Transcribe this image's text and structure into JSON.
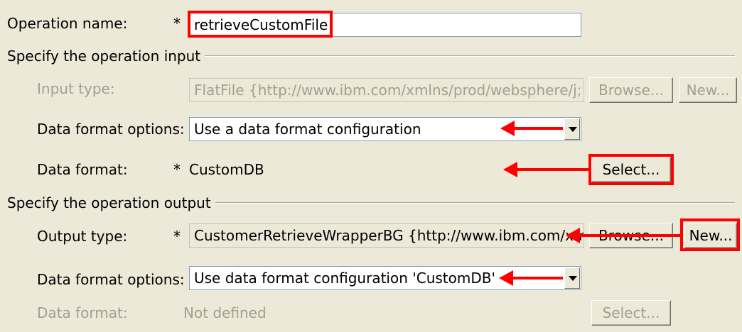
{
  "operation_name": {
    "label": "Operation name:",
    "asterisk": "*",
    "value": "retrieveCustomFile"
  },
  "input_group": {
    "title": "Specify the operation input",
    "input_type": {
      "label": "Input type:",
      "value": "FlatFile  {http://www.ibm.com/xmlns/prod/websphere/j;",
      "browse_label": "Browse...",
      "new_label": "New..."
    },
    "data_format_options": {
      "label": "Data format options:",
      "selected": "Use a data format configuration"
    },
    "data_format": {
      "label": "Data format:",
      "asterisk": "*",
      "value": "CustomDB",
      "select_label": "Select..."
    }
  },
  "output_group": {
    "title": "Specify the operation output",
    "output_type": {
      "label": "Output type:",
      "asterisk": "*",
      "value": "CustomerRetrieveWrapperBG  {http://www.ibm.com/xm",
      "browse_label": "Browse...",
      "new_label": "New..."
    },
    "data_format_options": {
      "label": "Data format options:",
      "selected": "Use data format configuration 'CustomDB'"
    },
    "data_format": {
      "label": "Data format:",
      "value": "Not defined",
      "select_label": "Select..."
    }
  },
  "annotation_color": "#ff0000"
}
